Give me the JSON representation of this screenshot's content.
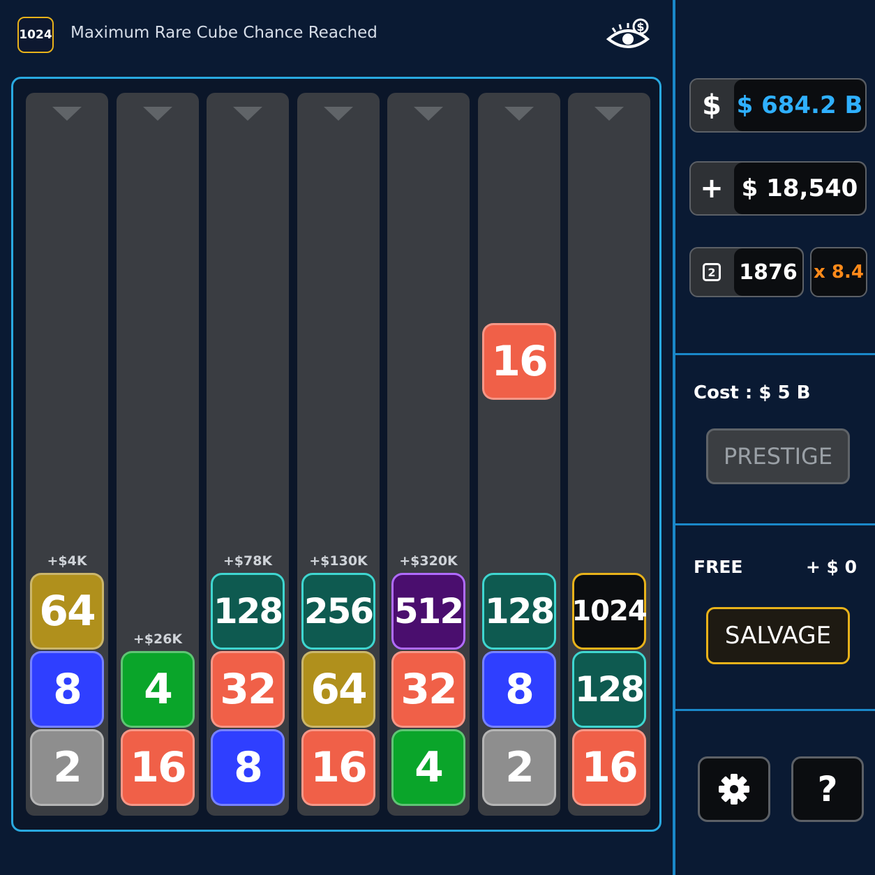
{
  "header": {
    "rare_badge": "1024",
    "rare_message": "Maximum Rare Cube Chance Reached",
    "eye_icon": "eye-dollar-icon"
  },
  "colors": {
    "2": "#8e8e8e",
    "4": "#0aa52a",
    "8": "#2f3fff",
    "16": "#f06048",
    "32": "#f06048",
    "64": "#b0901c",
    "128": "#0e5a50",
    "256": "#0e5a50",
    "512": "#4a0e6e",
    "1024": "#0b0d10",
    "accent": "#1a88c9",
    "gold": "#e8b21a",
    "money": "#2fb0ff",
    "multiplier": "#ff8a1a"
  },
  "columns": [
    {
      "label": "+$4K",
      "tiles": [
        "64",
        "8",
        "2"
      ]
    },
    {
      "label": "+$26K",
      "tiles": [
        "4",
        "16"
      ]
    },
    {
      "label": "+$78K",
      "tiles": [
        "128",
        "32",
        "8"
      ]
    },
    {
      "label": "+$130K",
      "tiles": [
        "256",
        "64",
        "16"
      ]
    },
    {
      "label": "+$320K",
      "tiles": [
        "512",
        "32",
        "4"
      ]
    },
    {
      "label": "",
      "tiles": [
        "16",
        "128",
        "8",
        "2"
      ]
    },
    {
      "label": "",
      "tiles": [
        "1024",
        "128",
        "16"
      ]
    }
  ],
  "stats": {
    "money_icon": "$",
    "money": "$ 684.2 B",
    "income_icon": "+",
    "income": "$ 18,540",
    "cube_icon": "2",
    "cube_count": "1876",
    "multiplier": "x 8.4"
  },
  "prestige": {
    "cost": "Cost : $ 5 B",
    "button": "PRESTIGE"
  },
  "salvage": {
    "free_label": "FREE",
    "free_value": "+ $ 0",
    "button": "SALVAGE"
  },
  "footer": {
    "settings_icon": "gear-icon",
    "help_label": "?"
  }
}
